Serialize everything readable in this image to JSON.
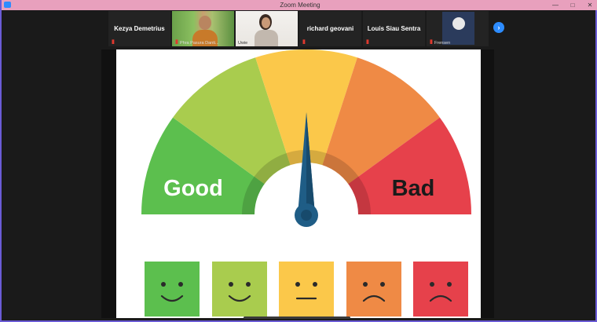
{
  "window": {
    "title": "Zoom Meeting"
  },
  "participants": [
    {
      "name": "Kezya Demetrius",
      "type": "name"
    },
    {
      "name": "Phra Pasura Danti...",
      "type": "video"
    },
    {
      "name": "Uwie",
      "type": "video"
    },
    {
      "name": "richard geovani",
      "type": "name"
    },
    {
      "name": "Louis Siau Sentra",
      "type": "name"
    },
    {
      "name": "Frensen",
      "type": "avatar"
    }
  ],
  "gauge": {
    "left_label": "Good",
    "right_label": "Bad",
    "segment_colors": [
      "#5cbf4e",
      "#a9cc4e",
      "#fbc84a",
      "#ef8a45",
      "#e6414b"
    ]
  },
  "faces": [
    {
      "mood": "happy",
      "color": "#5cbf4e"
    },
    {
      "mood": "happy",
      "color": "#a9cc4e"
    },
    {
      "mood": "neutral",
      "color": "#fbc84a"
    },
    {
      "mood": "sad",
      "color": "#ef8a45"
    },
    {
      "mood": "sad",
      "color": "#e6414b"
    }
  ],
  "icons": {
    "app": "zoom-icon",
    "minimize": "minimize-icon",
    "maximize": "maximize-icon",
    "close": "close-icon",
    "mic_muted": "mic-muted-icon",
    "next": "chevron-right-icon"
  }
}
